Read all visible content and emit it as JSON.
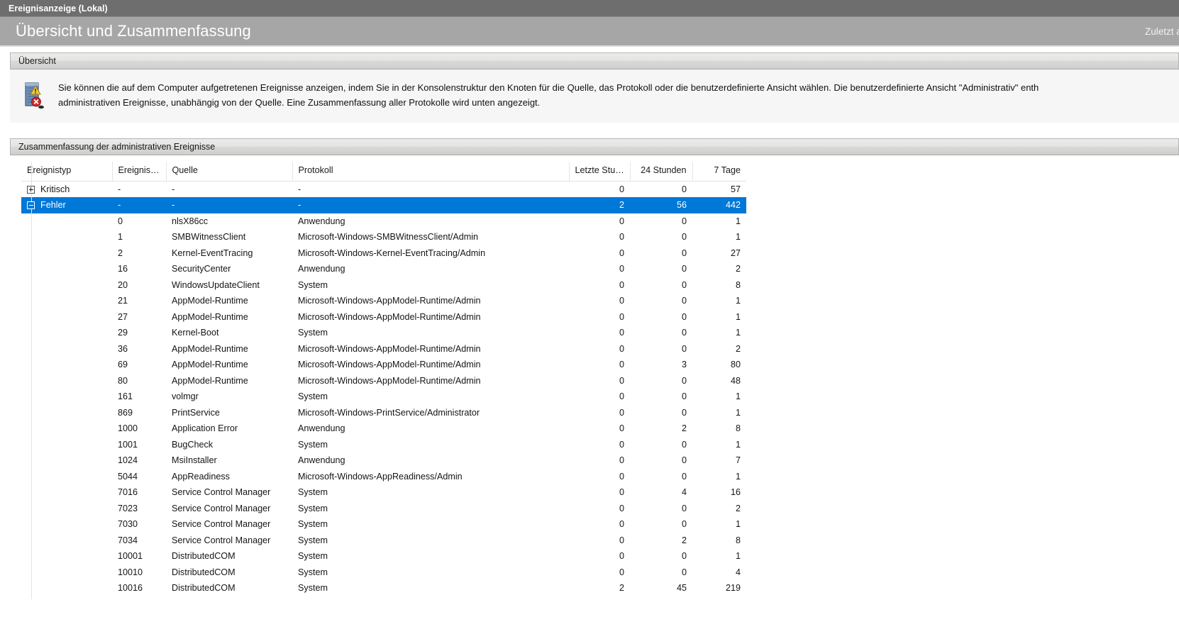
{
  "window": {
    "title": "Ereignisanzeige (Lokal)"
  },
  "banner": {
    "title": "Übersicht und Zusammenfassung",
    "refresh_label": "Zuletzt aktualis"
  },
  "overview": {
    "panel_title": "Übersicht",
    "icon": "event-log-warning-icon",
    "text_line1": "Sie können die auf dem Computer aufgetretenen Ereignisse anzeigen, indem Sie in der Konsolenstruktur den Knoten für die Quelle, das Protokoll oder die benutzerdefinierte Ansicht wählen. Die benutzerdefinierte Ansicht \"Administrativ\" enth",
    "text_line2": "administrativen Ereignisse, unabhängig von der Quelle. Eine Zusammenfassung aller Protokolle wird unten angezeigt."
  },
  "summary": {
    "panel_title": "Zusammenfassung der administrativen Ereignisse",
    "columns": [
      "Ereignistyp",
      "Ereignis…",
      "Quelle",
      "Protokoll",
      "Letzte Stu…",
      "24 Stunden",
      "7 Tage"
    ],
    "accent_color": "#0078d7",
    "rows": [
      {
        "type": "group",
        "toggle": "plus",
        "selected": false,
        "event_type": "Kritisch",
        "event_id": "-",
        "source": "-",
        "log": "-",
        "last_hour": "0",
        "last_24h": "0",
        "last_7d": "57"
      },
      {
        "type": "group",
        "toggle": "minus",
        "selected": true,
        "event_type": "Fehler",
        "event_id": "-",
        "source": "-",
        "log": "-",
        "last_hour": "2",
        "last_24h": "56",
        "last_7d": "442"
      },
      {
        "type": "child",
        "event_type": "",
        "event_id": "0",
        "source": "nlsX86cc",
        "log": "Anwendung",
        "last_hour": "0",
        "last_24h": "0",
        "last_7d": "1"
      },
      {
        "type": "child",
        "event_type": "",
        "event_id": "1",
        "source": "SMBWitnessClient",
        "log": "Microsoft-Windows-SMBWitnessClient/Admin",
        "last_hour": "0",
        "last_24h": "0",
        "last_7d": "1"
      },
      {
        "type": "child",
        "event_type": "",
        "event_id": "2",
        "source": "Kernel-EventTracing",
        "log": "Microsoft-Windows-Kernel-EventTracing/Admin",
        "last_hour": "0",
        "last_24h": "0",
        "last_7d": "27"
      },
      {
        "type": "child",
        "event_type": "",
        "event_id": "16",
        "source": "SecurityCenter",
        "log": "Anwendung",
        "last_hour": "0",
        "last_24h": "0",
        "last_7d": "2"
      },
      {
        "type": "child",
        "event_type": "",
        "event_id": "20",
        "source": "WindowsUpdateClient",
        "log": "System",
        "last_hour": "0",
        "last_24h": "0",
        "last_7d": "8"
      },
      {
        "type": "child",
        "event_type": "",
        "event_id": "21",
        "source": "AppModel-Runtime",
        "log": "Microsoft-Windows-AppModel-Runtime/Admin",
        "last_hour": "0",
        "last_24h": "0",
        "last_7d": "1"
      },
      {
        "type": "child",
        "event_type": "",
        "event_id": "27",
        "source": "AppModel-Runtime",
        "log": "Microsoft-Windows-AppModel-Runtime/Admin",
        "last_hour": "0",
        "last_24h": "0",
        "last_7d": "1"
      },
      {
        "type": "child",
        "event_type": "",
        "event_id": "29",
        "source": "Kernel-Boot",
        "log": "System",
        "last_hour": "0",
        "last_24h": "0",
        "last_7d": "1"
      },
      {
        "type": "child",
        "event_type": "",
        "event_id": "36",
        "source": "AppModel-Runtime",
        "log": "Microsoft-Windows-AppModel-Runtime/Admin",
        "last_hour": "0",
        "last_24h": "0",
        "last_7d": "2"
      },
      {
        "type": "child",
        "event_type": "",
        "event_id": "69",
        "source": "AppModel-Runtime",
        "log": "Microsoft-Windows-AppModel-Runtime/Admin",
        "last_hour": "0",
        "last_24h": "3",
        "last_7d": "80"
      },
      {
        "type": "child",
        "event_type": "",
        "event_id": "80",
        "source": "AppModel-Runtime",
        "log": "Microsoft-Windows-AppModel-Runtime/Admin",
        "last_hour": "0",
        "last_24h": "0",
        "last_7d": "48"
      },
      {
        "type": "child",
        "event_type": "",
        "event_id": "161",
        "source": "volmgr",
        "log": "System",
        "last_hour": "0",
        "last_24h": "0",
        "last_7d": "1"
      },
      {
        "type": "child",
        "event_type": "",
        "event_id": "869",
        "source": "PrintService",
        "log": "Microsoft-Windows-PrintService/Administrator",
        "last_hour": "0",
        "last_24h": "0",
        "last_7d": "1"
      },
      {
        "type": "child",
        "event_type": "",
        "event_id": "1000",
        "source": "Application Error",
        "log": "Anwendung",
        "last_hour": "0",
        "last_24h": "2",
        "last_7d": "8"
      },
      {
        "type": "child",
        "event_type": "",
        "event_id": "1001",
        "source": "BugCheck",
        "log": "System",
        "last_hour": "0",
        "last_24h": "0",
        "last_7d": "1"
      },
      {
        "type": "child",
        "event_type": "",
        "event_id": "1024",
        "source": "MsiInstaller",
        "log": "Anwendung",
        "last_hour": "0",
        "last_24h": "0",
        "last_7d": "7"
      },
      {
        "type": "child",
        "event_type": "",
        "event_id": "5044",
        "source": "AppReadiness",
        "log": "Microsoft-Windows-AppReadiness/Admin",
        "last_hour": "0",
        "last_24h": "0",
        "last_7d": "1"
      },
      {
        "type": "child",
        "event_type": "",
        "event_id": "7016",
        "source": "Service Control Manager",
        "log": "System",
        "last_hour": "0",
        "last_24h": "4",
        "last_7d": "16"
      },
      {
        "type": "child",
        "event_type": "",
        "event_id": "7023",
        "source": "Service Control Manager",
        "log": "System",
        "last_hour": "0",
        "last_24h": "0",
        "last_7d": "2"
      },
      {
        "type": "child",
        "event_type": "",
        "event_id": "7030",
        "source": "Service Control Manager",
        "log": "System",
        "last_hour": "0",
        "last_24h": "0",
        "last_7d": "1"
      },
      {
        "type": "child",
        "event_type": "",
        "event_id": "7034",
        "source": "Service Control Manager",
        "log": "System",
        "last_hour": "0",
        "last_24h": "2",
        "last_7d": "8"
      },
      {
        "type": "child",
        "event_type": "",
        "event_id": "10001",
        "source": "DistributedCOM",
        "log": "System",
        "last_hour": "0",
        "last_24h": "0",
        "last_7d": "1"
      },
      {
        "type": "child",
        "event_type": "",
        "event_id": "10010",
        "source": "DistributedCOM",
        "log": "System",
        "last_hour": "0",
        "last_24h": "0",
        "last_7d": "4"
      },
      {
        "type": "child",
        "event_type": "",
        "event_id": "10016",
        "source": "DistributedCOM",
        "log": "System",
        "last_hour": "2",
        "last_24h": "45",
        "last_7d": "219"
      }
    ]
  }
}
